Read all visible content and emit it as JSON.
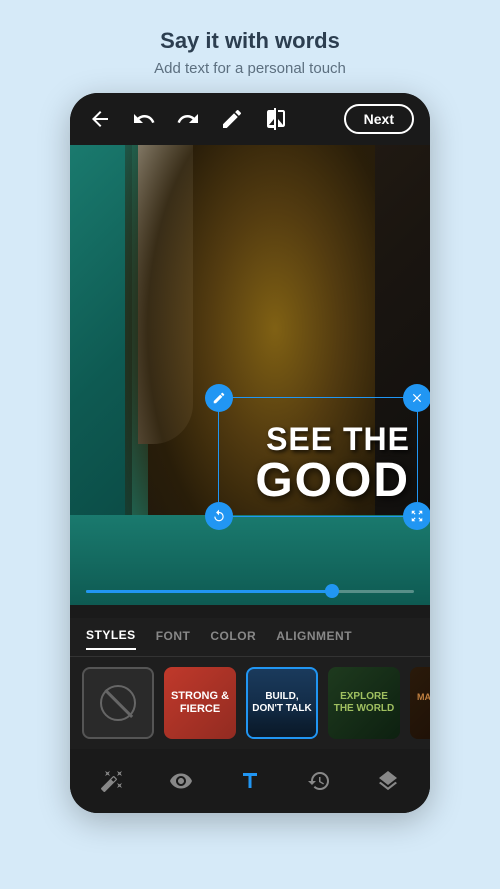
{
  "header": {
    "title": "Say it with words",
    "subtitle": "Add text for a personal touch"
  },
  "toolbar": {
    "next_label": "Next",
    "icons": [
      "back",
      "undo",
      "redo",
      "pen",
      "compare"
    ]
  },
  "text_overlay": {
    "line1": "SEE THE",
    "line2": "GOOD"
  },
  "tabs": {
    "items": [
      {
        "label": "STYLES",
        "active": true
      },
      {
        "label": "FONT",
        "active": false
      },
      {
        "label": "COLOR",
        "active": false
      },
      {
        "label": "ALIGNMENT",
        "active": false
      }
    ]
  },
  "style_items": [
    {
      "id": "none",
      "label": "",
      "selected": false
    },
    {
      "id": "strong",
      "label": "STRONG &\nFIERCE",
      "selected": false
    },
    {
      "id": "build",
      "label": "BUILD,\nDON'T TALK",
      "selected": true
    },
    {
      "id": "explore",
      "label": "EXPLORE\nTHE WORLD",
      "selected": false
    },
    {
      "id": "make",
      "label": "MAKE IT SIG-\nNIFIE...",
      "selected": false
    }
  ],
  "bottom_nav": {
    "items": [
      {
        "icon": "wand",
        "active": false
      },
      {
        "icon": "eye",
        "active": false
      },
      {
        "icon": "text",
        "active": true
      },
      {
        "icon": "history",
        "active": false
      },
      {
        "icon": "layers",
        "active": false
      }
    ]
  }
}
